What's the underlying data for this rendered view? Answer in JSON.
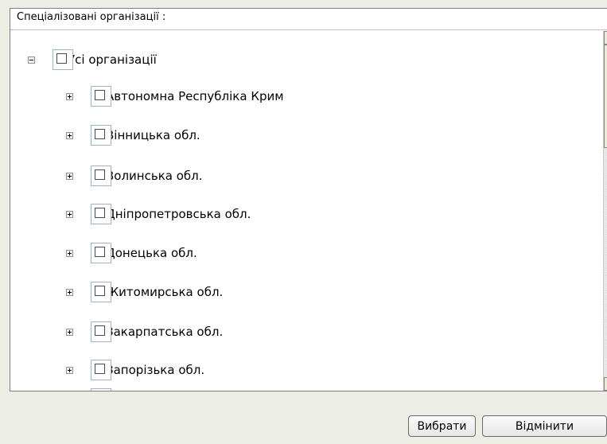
{
  "panel": {
    "title": "Спеціалізовані організації :"
  },
  "tree": {
    "root": {
      "label": "Усі організації",
      "expanded": true,
      "checked": false
    },
    "items": [
      {
        "label": "Автономна Республіка Крим",
        "expanded": false,
        "checked": false
      },
      {
        "label": "Вінницька обл.",
        "expanded": false,
        "checked": false
      },
      {
        "label": "Волинська обл.",
        "expanded": false,
        "checked": false
      },
      {
        "label": "Дніпропетровська обл.",
        "expanded": false,
        "checked": false
      },
      {
        "label": "Донецька обл.",
        "expanded": false,
        "checked": false
      },
      {
        "label": "Житомирська обл.",
        "expanded": false,
        "checked": false
      },
      {
        "label": "Закарпатська обл.",
        "expanded": false,
        "checked": false
      },
      {
        "label": "Запорізька обл.",
        "expanded": false,
        "checked": false
      }
    ]
  },
  "buttons": {
    "select_label": "Вибрати",
    "cancel_label": "Відмінити"
  },
  "icons": {
    "collapse": "minus-box-icon",
    "expand": "plus-box-icon",
    "scroll_up": "arrow-up-icon",
    "scroll_down": "arrow-down-icon"
  }
}
